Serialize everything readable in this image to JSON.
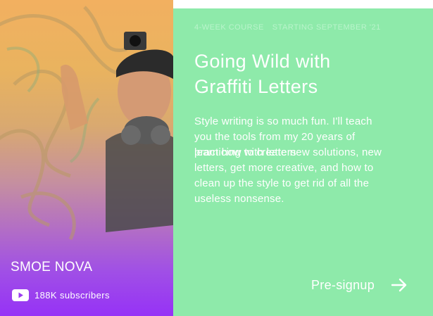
{
  "creator": {
    "name": "SMOE NOVA",
    "subscribers": "188K subscribers",
    "platform_icon": "youtube-icon"
  },
  "course": {
    "duration": "4-WEEK COURSE",
    "start": "STARTING SEPTEMBER '21",
    "title_line1": "Going Wild with",
    "title_line2": "Graffiti Letters",
    "description": {
      "line1": "Style writing is so much fun. I'll teach",
      "line2": "you the tools from my 20 years of",
      "line3a": "practicing with letters",
      "line3b": "learn how to create new solutions, new",
      "line4": "letters, get more creative, and how to",
      "line5": "clean up the style to get rid of all the",
      "line6": "useless nonsense."
    }
  },
  "cta": {
    "label": "Pre-signup",
    "icon": "arrow-right-icon"
  },
  "colors": {
    "panel_green": "#8eeaaa",
    "gradient_top": "#f2b060",
    "gradient_bottom": "#9632f6"
  }
}
